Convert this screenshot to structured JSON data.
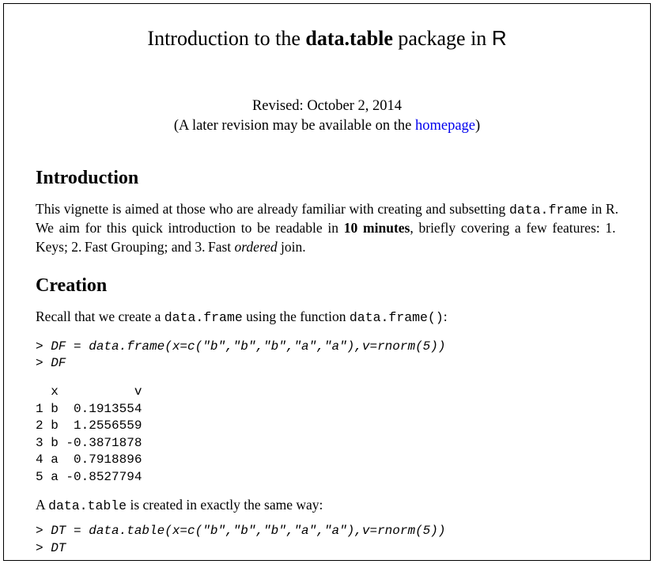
{
  "title": {
    "part1": "Introduction to the ",
    "bold": "data.table",
    "part2": " package in ",
    "sans": "R"
  },
  "revised": {
    "line1": "Revised: October 2, 2014",
    "line2_pre": "(A later revision may be available on the ",
    "link": "homepage",
    "line2_post": ")"
  },
  "section_intro_heading": "Introduction",
  "intro_para": {
    "p1": "This vignette is aimed at those who are already familiar with creating and subsetting ",
    "tt1": "data.frame",
    "p2": " in ",
    "sans1": "R",
    "p3": ". We aim for this quick introduction to be readable in ",
    "bold1": "10 minutes",
    "p4": ", briefly covering a few features: 1. Keys; 2. Fast Grouping; and 3. Fast ",
    "italic1": "ordered",
    "p5": " join."
  },
  "section_creation_heading": "Creation",
  "creation_intro": {
    "p1": "Recall that we create a ",
    "tt1": "data.frame",
    "p2": " using the function ",
    "tt2": "data.frame()",
    "p3": ":"
  },
  "code1": "> DF = data.frame(x=c(\"b\",\"b\",\"b\",\"a\",\"a\"),v=rnorm(5))\n> DF",
  "output1": "  x          v\n1 b  0.1913554\n2 b  1.2556559\n3 b -0.3871878\n4 a  0.7918896\n5 a -0.8527794",
  "between_para": {
    "p1": "A ",
    "tt1": "data.table",
    "p2": " is created in exactly the same way:"
  },
  "code2": "> DT = data.table(x=c(\"b\",\"b\",\"b\",\"a\",\"a\"),v=rnorm(5))\n> DT"
}
